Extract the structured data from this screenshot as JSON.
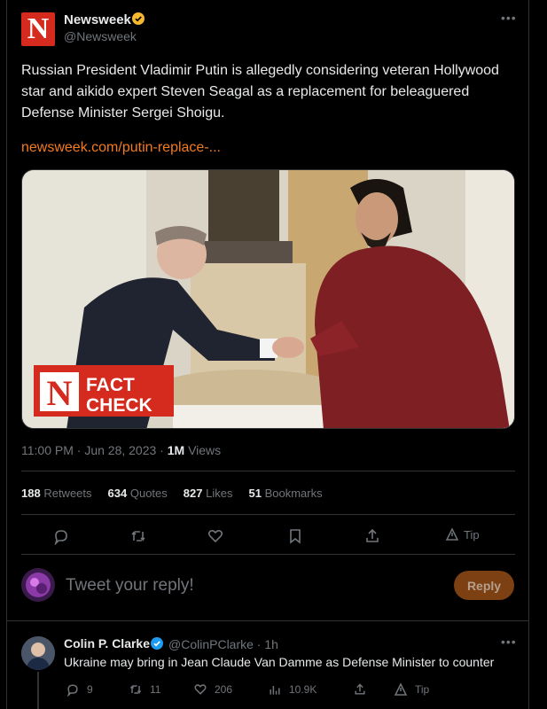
{
  "tweet": {
    "author_name": "Newsweek",
    "author_handle": "@Newsweek",
    "avatar_letter": "N",
    "text": "Russian President Vladimir Putin is allegedly considering veteran Hollywood star and aikido expert Steven Seagal as a replacement for beleaguered Defense Minister Sergei Shoigu.",
    "link": "newsweek.com/putin-replace-...",
    "media_badge_letter": "N",
    "media_badge_line1": "FACT",
    "media_badge_line2": "CHECK",
    "timestamp": "11:00 PM · Jun 28, 2023 · ",
    "views_count": "1M",
    "views_label": " Views"
  },
  "stats": {
    "retweets_count": "188",
    "retweets_label": "Retweets",
    "quotes_count": "634",
    "quotes_label": "Quotes",
    "likes_count": "827",
    "likes_label": "Likes",
    "bookmarks_count": "51",
    "bookmarks_label": "Bookmarks"
  },
  "actions": {
    "tip_label": "Tip"
  },
  "reply_box": {
    "placeholder": "Tweet your reply!",
    "button_label": "Reply"
  },
  "comment": {
    "author_name": "Colin P. Clarke",
    "author_handle": "@ColinPClarke · 1h",
    "text": "Ukraine may bring in Jean Claude Van Damme as Defense Minister to counter",
    "replies": "9",
    "retweets": "11",
    "likes": "206",
    "views": "10.9K",
    "tip_label": "Tip"
  },
  "colors": {
    "accent": "#f27b20",
    "brand_red": "#d52b1e",
    "verified": "#f5b82e",
    "verified_blue": "#1d9bf0"
  }
}
